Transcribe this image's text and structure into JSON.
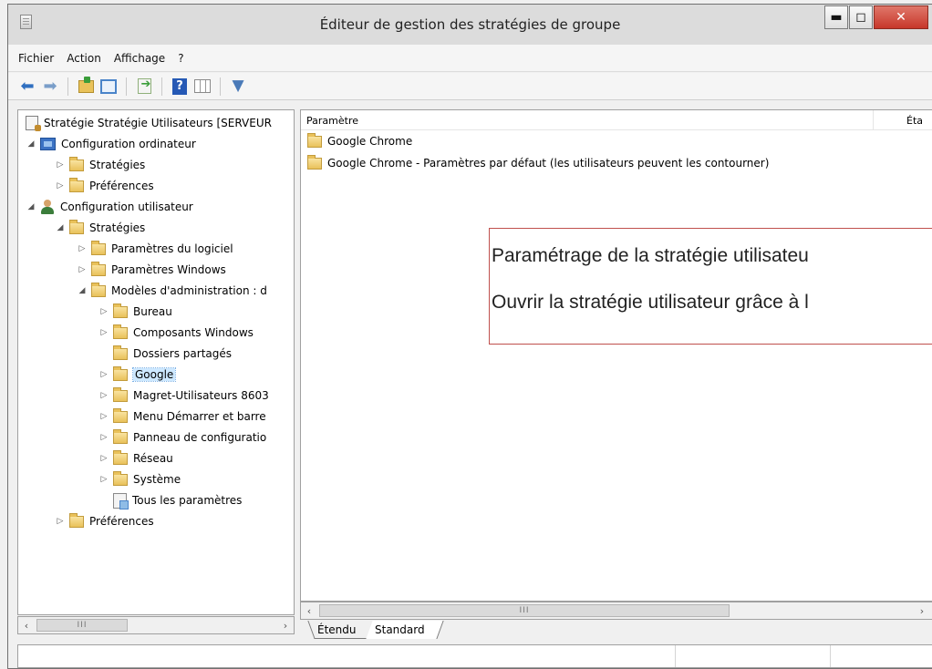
{
  "window": {
    "title": "Éditeur de gestion des stratégies de groupe",
    "controls": {
      "minimize": "▬",
      "maximize": "◻",
      "close": "✕"
    }
  },
  "menu": {
    "items": [
      "Fichier",
      "Action",
      "Affichage",
      "?"
    ]
  },
  "toolbar": {
    "icons": [
      "back-arrow-icon",
      "forward-arrow-icon",
      "up-folder-icon",
      "show-hide-tree-icon",
      "export-list-icon",
      "help-icon",
      "properties-grid-icon",
      "filter-icon"
    ]
  },
  "tree": {
    "root": "Stratégie Stratégie Utilisateurs [SERVEUR",
    "computer_config": "Configuration ordinateur",
    "computer_strategies": "Stratégies",
    "computer_preferences": "Préférences",
    "user_config": "Configuration utilisateur",
    "user_strategies": "Stratégies",
    "software_settings": "Paramètres du logiciel",
    "windows_settings": "Paramètres Windows",
    "admin_templates": "Modèles d'administration : d",
    "desktop": "Bureau",
    "windows_components": "Composants Windows",
    "shared_folders": "Dossiers partagés",
    "google": "Google",
    "magret": "Magret-Utilisateurs 8603",
    "start_menu": "Menu Démarrer et barre",
    "control_panel": "Panneau de configuratio",
    "network": "Réseau",
    "system": "Système",
    "all_settings": "Tous les paramètres",
    "user_preferences": "Préférences"
  },
  "list": {
    "column_param": "Paramètre",
    "column_state": "Éta",
    "rows": [
      "Google Chrome",
      "Google Chrome - Paramètres par défaut (les utilisateurs peuvent les contourner)"
    ]
  },
  "callout": {
    "line1": "Paramétrage de la stratégie utilisateu",
    "line2": "Ouvrir la stratégie utilisateur grâce à l"
  },
  "scroll": {
    "left": "‹",
    "right": "›",
    "thumb": "III"
  },
  "tabs": {
    "extended": "Étendu",
    "standard": "Standard"
  },
  "colors": {
    "selection": "#cde8ff",
    "callout_border": "#c0504d",
    "close_button": "#c7372a"
  }
}
